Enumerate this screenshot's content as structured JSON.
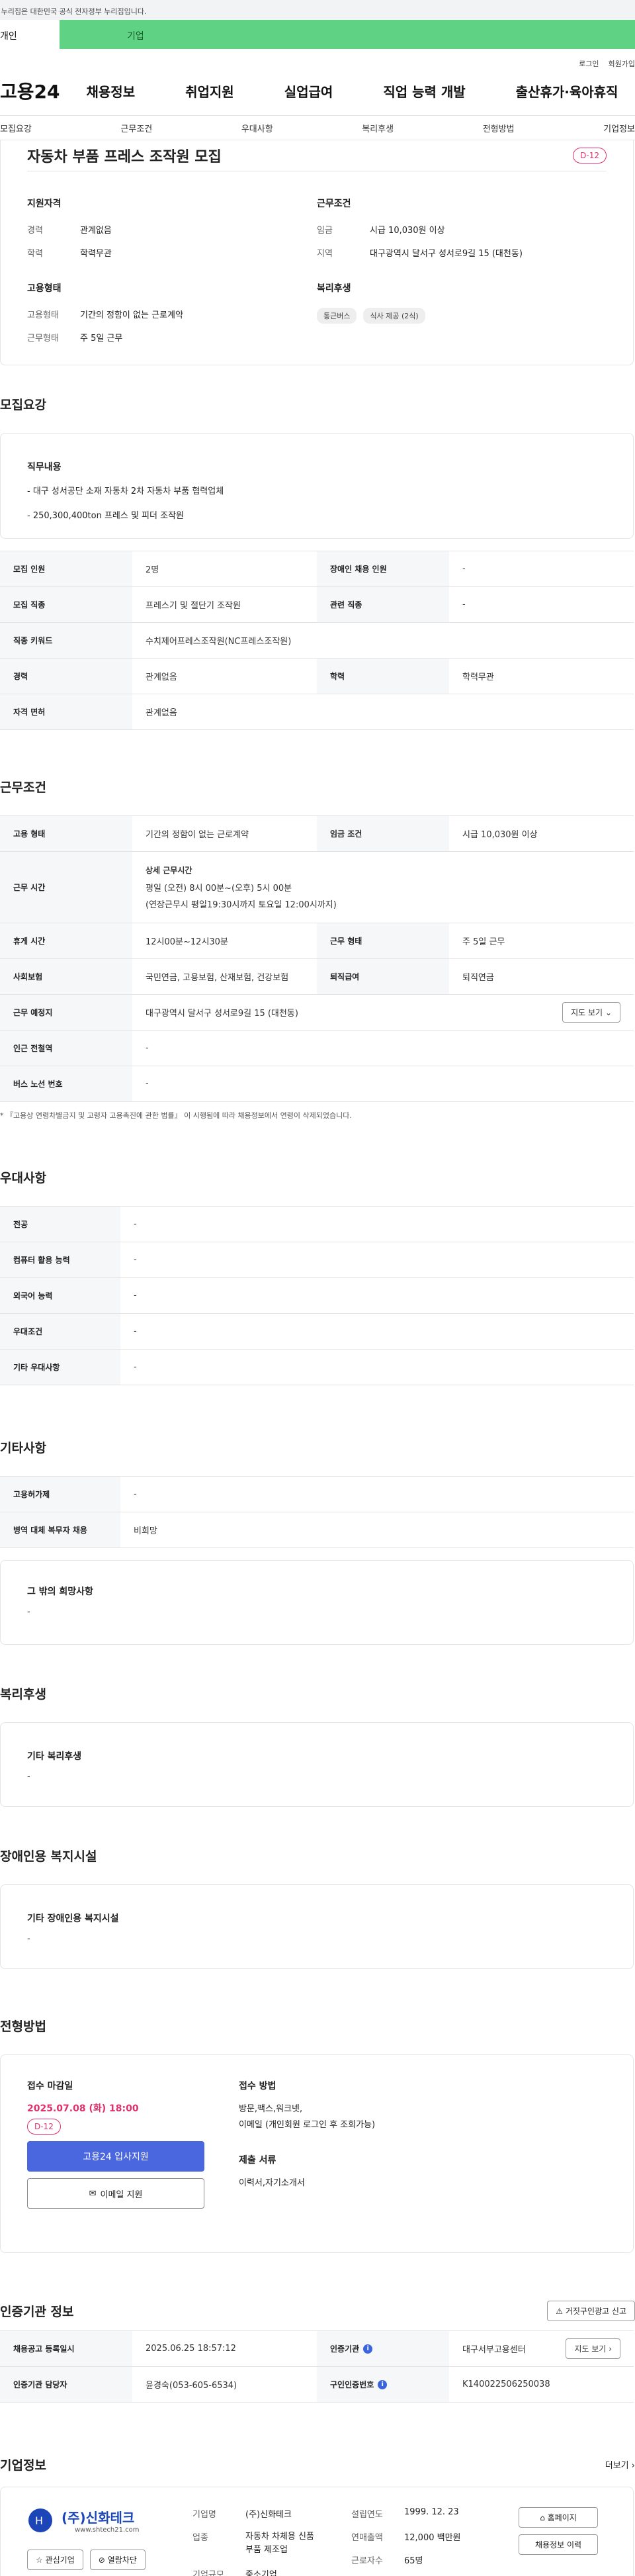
{
  "gov_banner": "이 누리집은 대한민국 공식 전자정부 누리집입니다.",
  "tabs": {
    "person": "개인",
    "company": "기업"
  },
  "util": {
    "login": "로그인",
    "join": "회원가입"
  },
  "gnb": {
    "logo": "고용24",
    "menu": [
      "채용정보",
      "취업지원",
      "실업급여",
      "직업 능력 개발",
      "출산휴가·육아휴직"
    ]
  },
  "subnav": [
    "모집요강",
    "근무조건",
    "우대사항",
    "복리후생",
    "전형방법",
    "기업정보"
  ],
  "summary": {
    "title": "자동차 부품 프레스 조작원 모집",
    "dday": "D-12",
    "qual_title": "지원자격",
    "career_k": "경력",
    "career_v": "관계없음",
    "edu_k": "학력",
    "edu_v": "학력무관",
    "cond_title": "근무조건",
    "wage_k": "임금",
    "wage_v": "시급 10,030원 이상",
    "area_k": "지역",
    "area_v": "대구광역시 달서구 성서로9길 15 (대천동)",
    "emp_title": "고용형태",
    "emp_k": "고용형태",
    "emp_v": "기간의 정함이 없는 근로계약",
    "wk_k": "근무형태",
    "wk_v": "주 5일 근무",
    "wel_title": "복리후생",
    "wel_tags": [
      "통근버스",
      "식사 제공 (2식)"
    ]
  },
  "recruit": {
    "heading": "모집요강",
    "duty_title": "직무내용",
    "duty_lines": [
      "- 대구 성서공단 소재 자동차 2차 자동차 부품 협력업체",
      "- 250,300,400ton 프레스 및 피더 조작원"
    ],
    "rows": [
      {
        "k1": "모집 인원",
        "v1": "2명",
        "k2": "장애인 채용 인원",
        "v2": "-"
      },
      {
        "k1": "모집 직종",
        "v1": "프레스기 및 절단기 조작원",
        "k2": "관련 직종",
        "v2": "-"
      },
      {
        "k1": "직종 키워드",
        "v1": "수치제어프레스조작원(NC프레스조작원)"
      },
      {
        "k1": "경력",
        "v1": "관계없음",
        "k2": "학력",
        "v2": "학력무관"
      },
      {
        "k1": "자격 면허",
        "v1": "관계없음"
      }
    ]
  },
  "work": {
    "heading": "근무조건",
    "emp_k": "고용 형태",
    "emp_v": "기간의 정함이 없는 근로계약",
    "wage_k": "임금 조건",
    "wage_v": "시급 10,030원 이상",
    "time_k": "근무 시간",
    "time_title": "상세 근무시간",
    "time_l1": "평일 (오전) 8시 00분~(오후) 5시 00분",
    "time_l2": "(연장근무시 평일19:30시까지 토요일 12:00시까지)",
    "rest_k": "휴게 시간",
    "rest_v": "12시00분~12시30분",
    "type_k": "근무 형태",
    "type_v": "주 5일 근무",
    "ins_k": "사회보험",
    "ins_v": "국민연금, 고용보험, 산재보험, 건강보험",
    "ret_k": "퇴직급여",
    "ret_v": "퇴직연금",
    "place_k": "근무 예정지",
    "place_v": "대구광역시 달서구 성서로9길 15 (대천동)",
    "map_btn": "지도 보기",
    "sub_k": "인근 전철역",
    "sub_v": "-",
    "bus_k": "버스 노선 번호",
    "bus_v": "-",
    "note": "* 『고용상 연령차별금지 및 고령자 고용촉진에 관한 법률』 이 시행됨에 따라 채용정보에서 연령이 삭제되었습니다."
  },
  "pref": {
    "heading": "우대사항",
    "rows": [
      {
        "k": "전공",
        "v": "-"
      },
      {
        "k": "컴퓨터 활용 능력",
        "v": "-"
      },
      {
        "k": "외국어 능력",
        "v": "-"
      },
      {
        "k": "우대조건",
        "v": "-"
      },
      {
        "k": "기타 우대사항",
        "v": "-"
      }
    ]
  },
  "etc": {
    "heading": "기타사항",
    "rows": [
      {
        "k": "고용허가제",
        "v": "-"
      },
      {
        "k": "병역 대체 복무자 채용",
        "v": "비희망"
      }
    ],
    "box_title": "그 밖의 희망사항",
    "box_v": "-"
  },
  "welfare": {
    "heading": "복리후생",
    "box_title": "기타 복리후생",
    "box_v": "-"
  },
  "disabled": {
    "heading": "장애인용 복지시설",
    "box_title": "기타 장애인용 복지시설",
    "box_v": "-"
  },
  "selection": {
    "heading": "전형방법",
    "deadline_title": "접수 마감일",
    "deadline": "2025.07.08 (화) 18:00",
    "dday": "D-12",
    "apply_btn": "고용24 입사지원",
    "email_btn": "이메일 지원",
    "method_title": "접수 방법",
    "method_v": "방문,팩스,워크넷,\n이메일 (개인회원 로그인 후 조회가능)",
    "docs_title": "제출 서류",
    "docs_v": "이력서,자기소개서"
  },
  "cert": {
    "heading": "인증기관 정보",
    "report_btn": "거짓구인광고 신고",
    "reg_k": "채용공고 등록일시",
    "reg_v": "2025.06.25 18:57:12",
    "org_k": "인증기관",
    "org_v": "대구서부고용센터",
    "map_btn": "지도 보기",
    "mgr_k": "인증기관 담당자",
    "mgr_v": "윤경숙(053-605-6534)",
    "num_k": "구인인증번호",
    "num_v": "K140022506250038"
  },
  "company": {
    "heading": "기업정보",
    "more": "더보기",
    "logo_text": "(주)신화테크",
    "logo_url": "www.shtech21.com",
    "fav_btn": "관심기업",
    "block_btn": "열람차단",
    "name_k": "기업명",
    "name_v": "(주)신화테크",
    "ind_k": "업종",
    "ind_v": "자동차 차체용 신품 부품 제조업",
    "size_k": "기업규모",
    "size_v": "중소기업",
    "est_k": "설립연도",
    "est_v": "1999. 12. 23",
    "sales_k": "연매출액",
    "sales_v": "12,000 백만원",
    "emp_k": "근로자수",
    "emp_v": "65명",
    "home_btn": "홈페이지",
    "jobs_btn": "채용정보 이력"
  }
}
